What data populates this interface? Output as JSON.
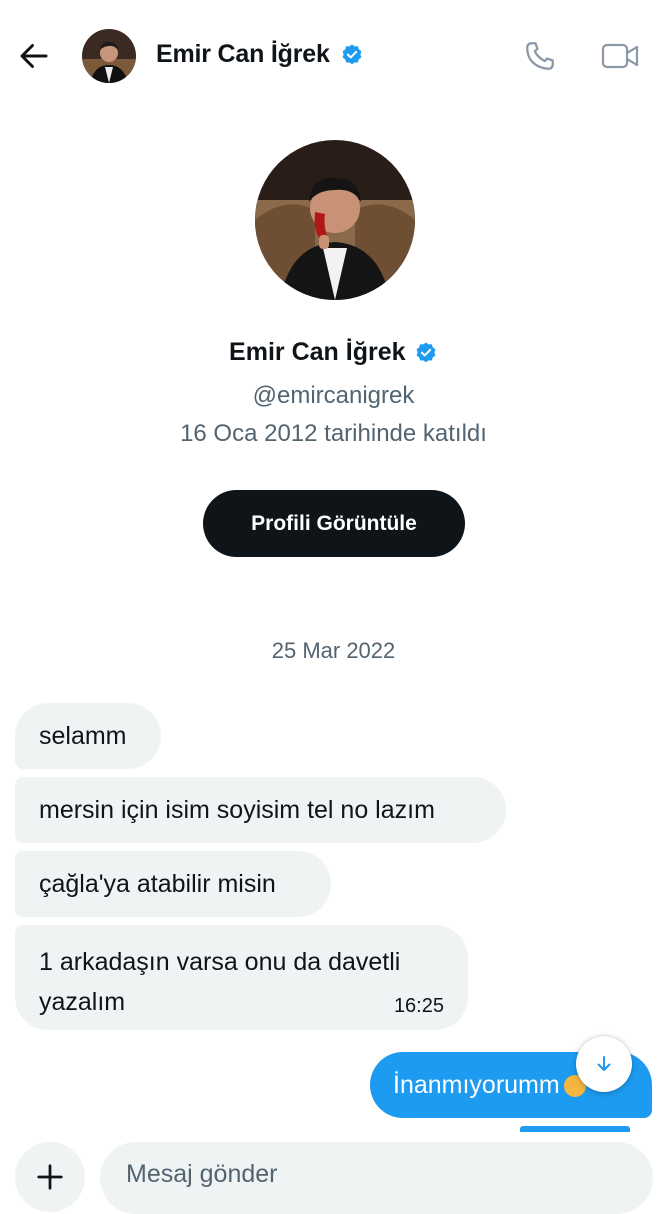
{
  "header": {
    "name": "Emir Can İğrek",
    "back_icon": "arrow-left-icon",
    "call_icon": "phone-icon",
    "video_icon": "video-camera-icon",
    "verified_color": "#1d9bf0"
  },
  "profile": {
    "name": "Emir Can İğrek",
    "handle": "@emircanigrek",
    "joined": "16 Oca 2012 tarihinde katıldı",
    "view_profile_label": "Profili Görüntüle"
  },
  "conversation": {
    "date": "25 Mar 2022",
    "received": [
      {
        "text": "selamm"
      },
      {
        "text": "mersin için isim soyisim tel no lazım"
      },
      {
        "text": "çağla'ya atabilir misin"
      },
      {
        "text": "1 arkadaşın varsa onu da davetli yazalım",
        "time": "16:25"
      }
    ],
    "sent": [
      {
        "text": "İnanmıyorumm"
      }
    ]
  },
  "composer": {
    "placeholder": "Mesaj gönder",
    "add_icon": "plus-icon",
    "scroll_icon": "arrow-down-icon"
  },
  "colors": {
    "accent": "#1d9bf0",
    "bubble_received": "#eff3f4",
    "text_secondary": "#536471",
    "button_dark": "#0f1419"
  }
}
